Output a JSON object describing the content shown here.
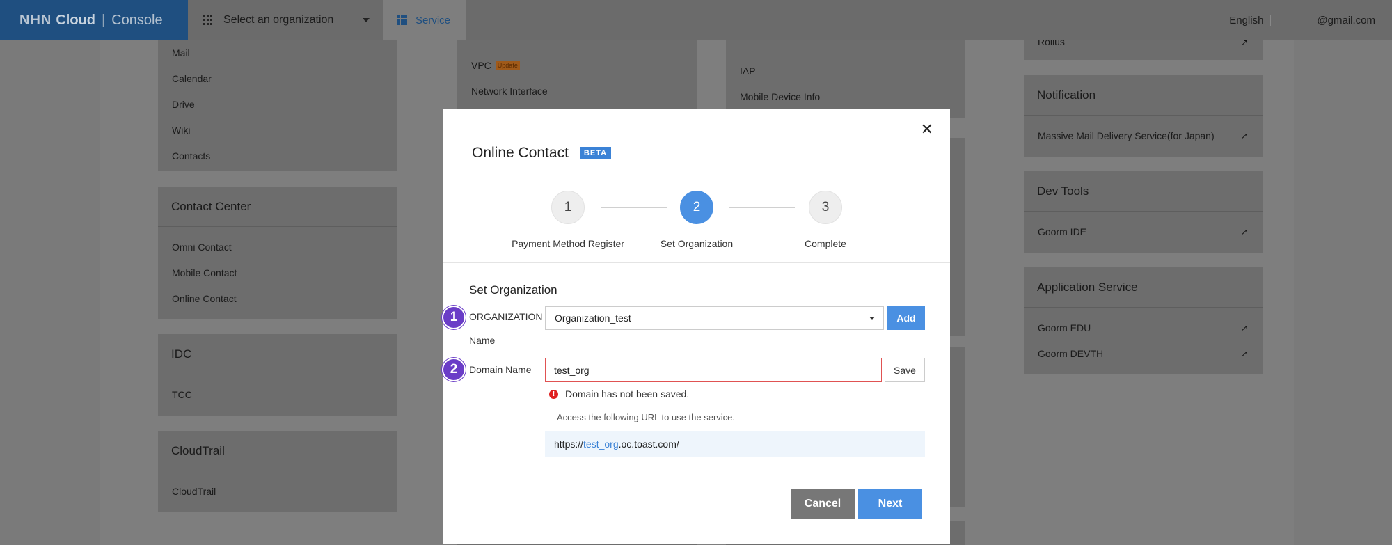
{
  "topbar": {
    "brand_logo": "NHN",
    "brand_cloud": "Cloud",
    "brand_separator": "|",
    "brand_console": "Console",
    "org_select_label": "Select an organization",
    "service_tab_label": "Service",
    "language": "English",
    "email": "@gmail.com"
  },
  "background": {
    "left_column": {
      "top_card_items": [
        "Mail",
        "Calendar",
        "Drive",
        "Wiki",
        "Contacts"
      ],
      "contact_center": {
        "title": "Contact Center",
        "items": [
          "Omni Contact",
          "Mobile Contact",
          "Online Contact"
        ]
      },
      "idc": {
        "title": "IDC",
        "items": [
          "TCC"
        ]
      },
      "cloudtrail": {
        "title": "CloudTrail",
        "items": [
          "CloudTrail"
        ]
      }
    },
    "middle_column": {
      "vpc_label": "VPC",
      "vpc_tag": "Update",
      "network_interface": "Network Interface"
    },
    "right_middle_column": {
      "items": [
        "IAP",
        "Mobile Device Info"
      ]
    },
    "right_column": {
      "top_item": "Rollus",
      "notification": {
        "title": "Notification",
        "items": [
          "Massive Mail Delivery Service(for Japan)"
        ]
      },
      "dev_tools": {
        "title": "Dev Tools",
        "items": [
          "Goorm IDE"
        ]
      },
      "application_service": {
        "title": "Application Service",
        "items": [
          "Goorm EDU",
          "Goorm DEVTH"
        ]
      }
    }
  },
  "modal": {
    "close_glyph": "✕",
    "title": "Online Contact",
    "beta_badge": "BETA",
    "steps": [
      {
        "number": "1",
        "label": "Payment Method Register"
      },
      {
        "number": "2",
        "label": "Set Organization"
      },
      {
        "number": "3",
        "label": "Complete"
      }
    ],
    "active_step": 2,
    "section_title": "Set Organization",
    "annotation_1": "1",
    "annotation_2": "2",
    "org_label_line1": "ORGANIZATION",
    "org_label_line2": "Name",
    "org_selected": "Organization_test",
    "add_label": "Add",
    "domain_label": "Domain Name",
    "domain_value": "test_org",
    "save_label": "Save",
    "error_glyph": "!",
    "error_message": "Domain has not been saved.",
    "hint": "Access the following URL to use the service.",
    "url_prefix": "https://",
    "url_domain": "test_org",
    "url_suffix": ".oc.toast.com/",
    "cancel_label": "Cancel",
    "next_label": "Next"
  },
  "colors": {
    "accent": "#4a90e2",
    "annotation": "#6a3dc7",
    "error": "#e02020"
  }
}
